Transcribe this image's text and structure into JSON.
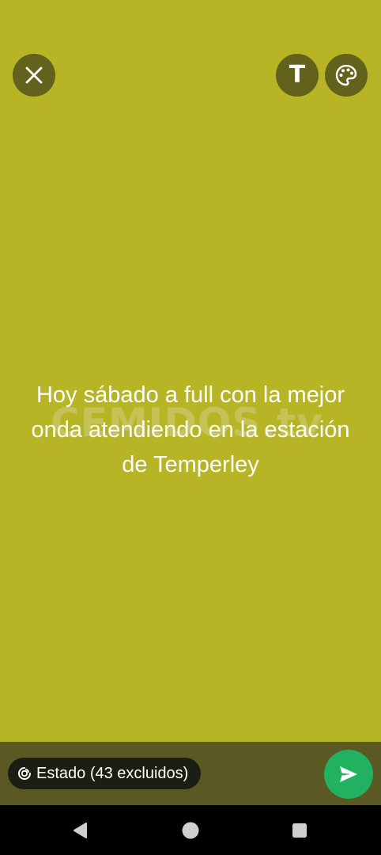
{
  "status_composer": {
    "text": "Hoy sábado a full con la mejor onda atendiendo en la estación de Temperley",
    "background_color": "#b7b526",
    "watermark_text": "CEMIDOS.tv"
  },
  "top_bar": {
    "close_icon": "close-icon",
    "text_tool_glyph": "T",
    "palette_icon": "palette-icon"
  },
  "bottom_bar": {
    "audience_label": "Estado (43 excluidos)",
    "audience_icon": "status-ring-icon",
    "send_icon": "send-icon",
    "send_color": "#21b160"
  },
  "nav": {
    "back_icon": "back-triangle-icon",
    "home_icon": "home-circle-icon",
    "recents_icon": "recents-square-icon"
  }
}
